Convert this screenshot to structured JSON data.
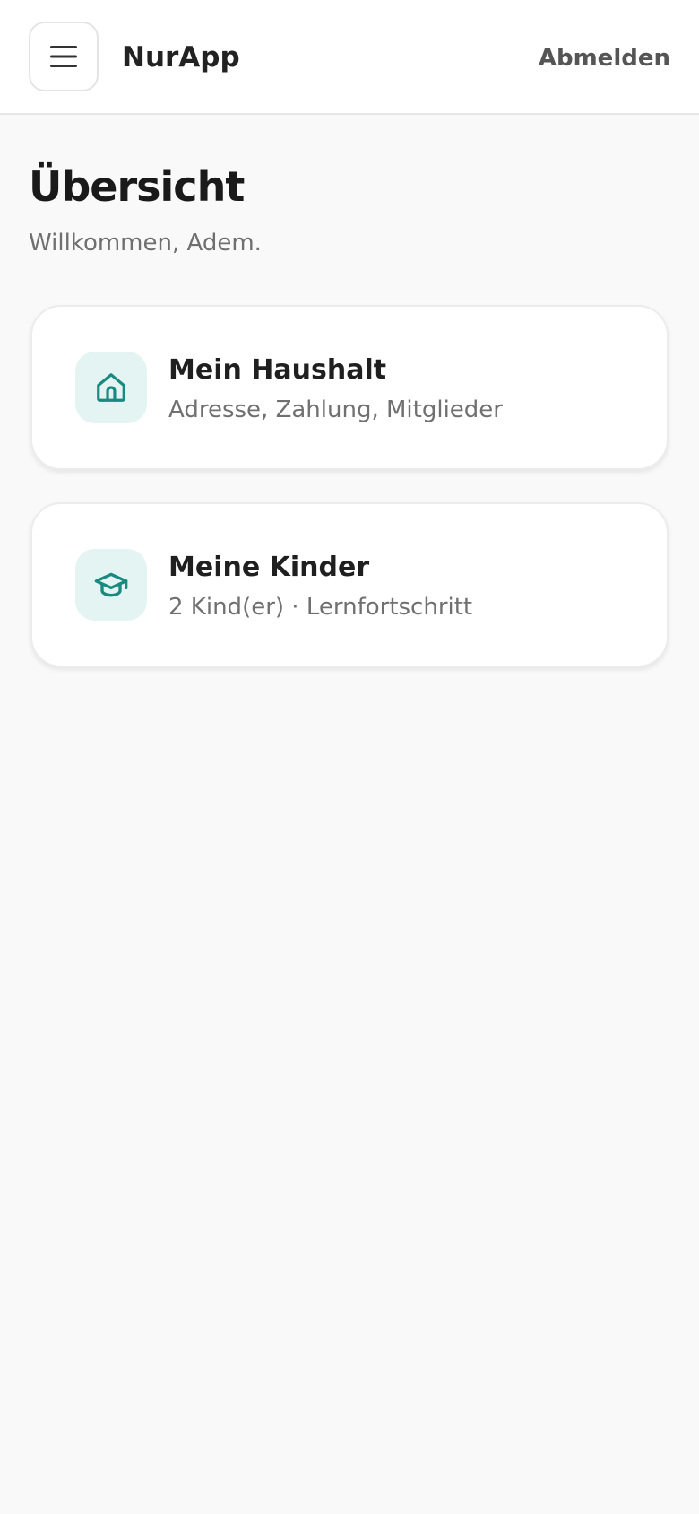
{
  "header": {
    "app_name": "NurApp",
    "logout_label": "Abmelden",
    "menu_icon": "hamburger-icon"
  },
  "main": {
    "title": "Übersicht",
    "welcome": "Willkommen, Adem.",
    "cards": [
      {
        "title": "Mein Haushalt",
        "subtitle": "Adresse, Zahlung, Mitglieder",
        "icon": "home-icon"
      },
      {
        "title": "Meine Kinder",
        "subtitle": "2 Kind(er) · Lernfortschritt",
        "icon": "graduation-cap-icon"
      }
    ]
  },
  "colors": {
    "accent": "#1a8a80",
    "icon_bg": "#e3f4f2",
    "background": "#f9f9f9"
  }
}
